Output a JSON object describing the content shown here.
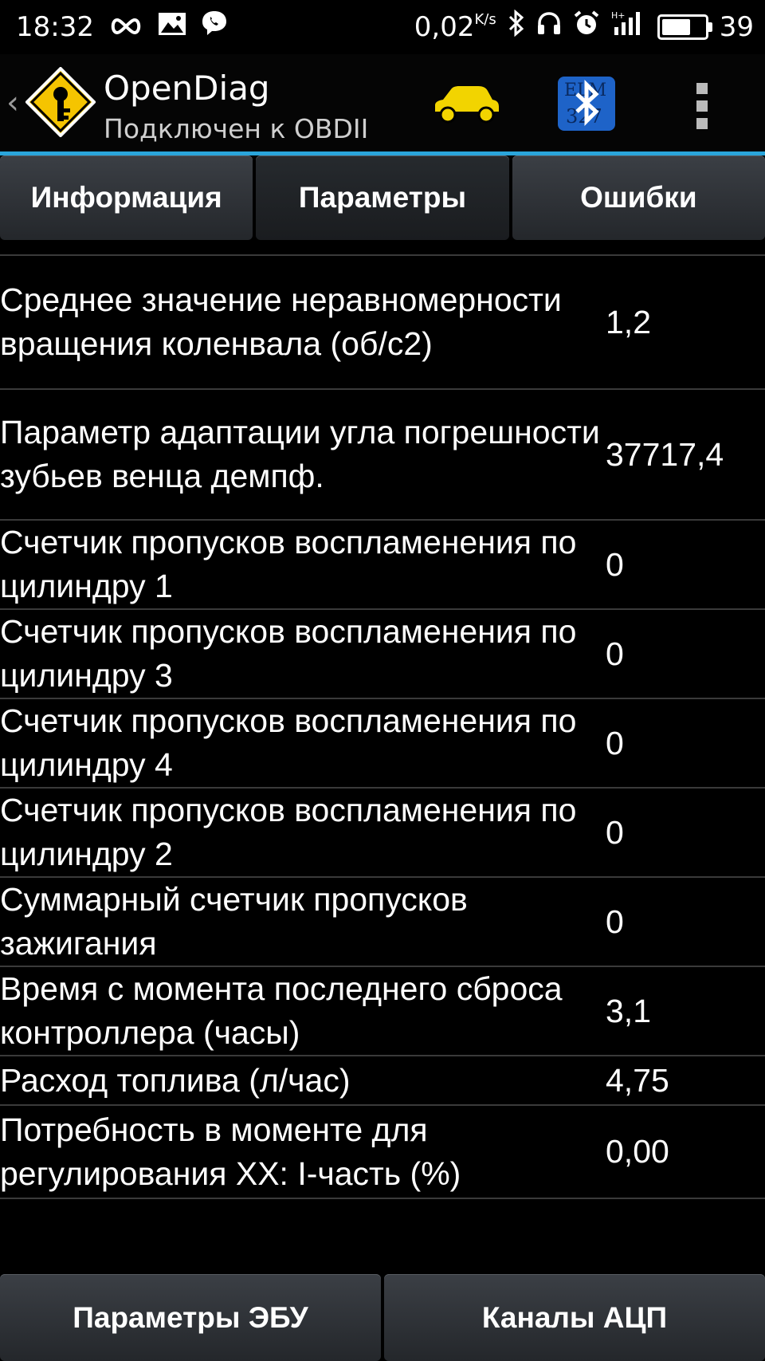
{
  "status": {
    "time": "18:32",
    "speed": "0,02",
    "speed_unit": "K/s",
    "battery": "39"
  },
  "appbar": {
    "title": "OpenDiag",
    "subtitle": "Подключен к OBDII"
  },
  "tabs": [
    {
      "label": "Информация"
    },
    {
      "label": "Параметры"
    },
    {
      "label": "Ошибки"
    }
  ],
  "rows": [
    {
      "label": "Среднее значение неравномерности вращения коленвала (об/с2)",
      "value": "1,2"
    },
    {
      "label": "Параметр адаптации угла погрешности зубьев венца демпф.",
      "value": "37717,4"
    },
    {
      "label": "Счетчик пропусков воспламенения по цилиндру 1",
      "value": "0"
    },
    {
      "label": "Счетчик пропусков воспламенения по цилиндру 3",
      "value": "0"
    },
    {
      "label": "Счетчик пропусков воспламенения по цилиндру 4",
      "value": "0"
    },
    {
      "label": "Счетчик пропусков воспламенения по цилиндру 2",
      "value": "0"
    },
    {
      "label": "Суммарный счетчик пропусков зажигания",
      "value": "0"
    },
    {
      "label": "Время с момента последнего сброса контроллера (часы)",
      "value": "3,1"
    },
    {
      "label": "Расход топлива (л/час)",
      "value": "4,75"
    },
    {
      "label": "Потребность в моменте для регулирования XX: I-часть (%)",
      "value": "0,00"
    }
  ],
  "bottom": {
    "left_label": "Параметры ЭБУ",
    "right_label": "Каналы АЦП"
  },
  "colors": {
    "accent": "#2aa5db",
    "logo_yellow": "#f5c400",
    "car_yellow": "#f2d400",
    "bt_blue": "#1e63c8"
  },
  "icons": [
    "infinity-icon",
    "image-icon",
    "viber-icon",
    "bluetooth-icon",
    "headphones-icon",
    "alarm-icon",
    "signal-icon",
    "battery-icon",
    "back-icon",
    "app-logo-icon",
    "car-icon",
    "bluetooth-elm-icon",
    "overflow-menu-icon"
  ]
}
